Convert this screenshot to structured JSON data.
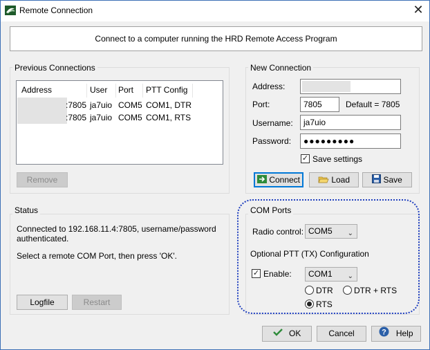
{
  "window": {
    "title": "Remote Connection",
    "close_symbol": "✕"
  },
  "banner": "Connect to a computer running the HRD Remote Access Program",
  "previous": {
    "label": "Previous Connections",
    "columns": [
      "Address",
      "User",
      "Port",
      "PTT Config"
    ],
    "rows": [
      {
        "address": ":7805",
        "user": "ja7uio",
        "port": "COM5",
        "ptt": "COM1, DTR"
      },
      {
        "address": ":7805",
        "user": "ja7uio",
        "port": "COM5",
        "ptt": "COM1, RTS"
      }
    ],
    "remove_label": "Remove"
  },
  "new_conn": {
    "label": "New Connection",
    "address_label": "Address:",
    "address_value": "",
    "port_label": "Port:",
    "port_value": "7805",
    "port_default": "Default = 7805",
    "username_label": "Username:",
    "username_value": "ja7uio",
    "password_label": "Password:",
    "password_value": "●●●●●●●●●",
    "save_settings_label": "Save settings",
    "save_settings_checked": "✓",
    "connect_label": "Connect",
    "load_label": "Load",
    "save_label": "Save"
  },
  "status": {
    "label": "Status",
    "line1": "Connected to 192.168.11.4:7805, username/password",
    "line2": "authenticated.",
    "line3": "Select a remote COM Port, then press 'OK'.",
    "logfile_label": "Logfile",
    "restart_label": "Restart"
  },
  "com_ports": {
    "label": "COM Ports",
    "radio_label": "Radio control:",
    "radio_value": "COM5",
    "ptt_label": "Optional PTT (TX) Configuration",
    "enable_label": "Enable:",
    "enable_checked": "✓",
    "ptt_value": "COM1",
    "opt_dtr": "DTR",
    "opt_dtr_rts": "DTR + RTS",
    "opt_rts": "RTS"
  },
  "footer": {
    "ok_label": "OK",
    "cancel_label": "Cancel",
    "help_label": "Help"
  },
  "colors": {
    "accent": "#0078d7",
    "highlight_border": "#1f3fbf"
  }
}
